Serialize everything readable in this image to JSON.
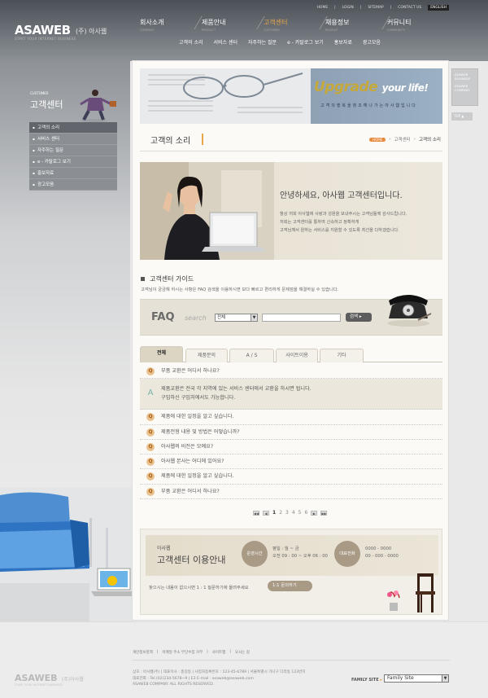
{
  "header": {
    "logo": "ASAWEB",
    "logo_kr": "(주) 아사웹",
    "tagline": "START YOUR INTERNET BUSINESS",
    "util": [
      "HOME",
      "LOGIN",
      "SITEMAP",
      "CONTACT US"
    ],
    "lang": "ENGLISH",
    "gnb": [
      {
        "kr": "회사소개",
        "en": "COMPANY"
      },
      {
        "kr": "제품안내",
        "en": "PRODUCT"
      },
      {
        "kr": "고객센터",
        "en": "CUSTOMER"
      },
      {
        "kr": "채용정보",
        "en": "RECRUIT"
      },
      {
        "kr": "커뮤니티",
        "en": "COMMUNITY"
      }
    ],
    "subnav": [
      "고객의 소리",
      "서비스 센터",
      "자주하는 질문",
      "e - 카탈로그 보기",
      "홍보자료",
      "광고모음"
    ]
  },
  "side": {
    "title_en": "CUSTOMER",
    "title": "고객센터",
    "menu": [
      "고객의 소리",
      "서비스 센터",
      "자주하는 질문",
      "e - 카탈로그 보기",
      "홍보자료",
      "광고모음"
    ]
  },
  "quick": {
    "lines": [
      "ASAWEB",
      "BUSINESS",
      "ASAWEB",
      "COMPANY"
    ],
    "top": "TOP"
  },
  "banner": {
    "upgrade": "Upgrade",
    "your_life": "your life!",
    "chars": "고객의행복을창조해나가는아사웹입니다"
  },
  "page": {
    "title": "고객의 소리",
    "crumb_home": "HOME",
    "crumb": [
      "고객센터",
      "고객의 소리"
    ]
  },
  "hello": {
    "heading": "안녕하세요, 아사웹 고객센터입니다.",
    "lines": [
      "항상 저희 아사웹에 사랑과 성원을 보내주시는 고객님들께 감사드립니다.",
      "저희는 고객센터를 통하여 신속하고 정확하게",
      "고객님께서 원하는 서비스를 지원할 수 있도록 최선을 다하겠습니다."
    ]
  },
  "guide": {
    "title": "고객센터 가이드",
    "desc": "고객님이 궁금해 하시는 사항은 FAQ 검색을 이용하시면 보다 빠르고 편리하게 문제점을 해결하실 수 있습니다."
  },
  "faq_search": {
    "label": "FAQ",
    "search_label": "search",
    "select_value": "전체",
    "button": "검색"
  },
  "tabs": [
    "전체",
    "제품문의",
    "A / S",
    "사이트이용",
    "기타"
  ],
  "faq": {
    "q_icon": "Q",
    "a_icon": "A",
    "first": "부품 교환은 어디서 하나요?",
    "answer": [
      "제품교환은 전국 각 지역에 있는 서비스 센터에서 교환을 하시면 됩니다.",
      "구입하신 구입처에서도 가능합니다."
    ],
    "rest": [
      "제품에 대한 일정을 알고 싶습니다.",
      "제품전형 내용 및 방법은 어떻습니까?",
      "아사웹의 비전은 모예요?",
      "아사웹 본사는 어디에 있어요?",
      "제품에 대한 일정을 알고 싶습니다.",
      "부품 교환은 어디서 하나요?"
    ]
  },
  "pager": {
    "pages": [
      "1",
      "2",
      "3",
      "4",
      "5",
      "6"
    ],
    "current": "1"
  },
  "info": {
    "small": "아사웹",
    "big": "고객센터 이용안내",
    "circle1": "운영시간",
    "hours": [
      "평일 : 월 ~ 금",
      "오전 09 : 00 ~ 오후 06 : 00"
    ],
    "circle2": "대표전화",
    "phones": [
      "0000 - 0000",
      "00 - 000 - 0000"
    ],
    "foot": "찾으시는 내용이 없으시면 1 : 1 질문하기에 올려주세요",
    "button": "1:1 문의하기"
  },
  "footer": {
    "links": [
      "개인정보정책",
      "|",
      "이메일 주소 무단수집 거부",
      "|",
      "사이트맵",
      "|",
      "오시는 길"
    ],
    "logo": "ASAWEB",
    "logo_kr": "(주)아사웹",
    "logo_tag": "START YOUR INTERNET BUSINESS",
    "addr": [
      "상호 : 아사웹(주)  |  대표이사 : 홍길동  |  사업자등록번호 : 123-45-6789  |  서울특별시 가나구 다라동 123번지",
      "대표전화 : Tel.(02)234-5678~9  |  E3  E-mail : asaweb@asaweb.com",
      "ASAWEB COMPANY. ALL RIGHTS RESERVED."
    ],
    "family_label": "FAMILY SITE",
    "family_value": "Family Site"
  },
  "colors": {
    "accent": "#e8a64a",
    "header": "#5d6268",
    "panel": "#fbfaf7",
    "beige": "#ddd5c3"
  }
}
